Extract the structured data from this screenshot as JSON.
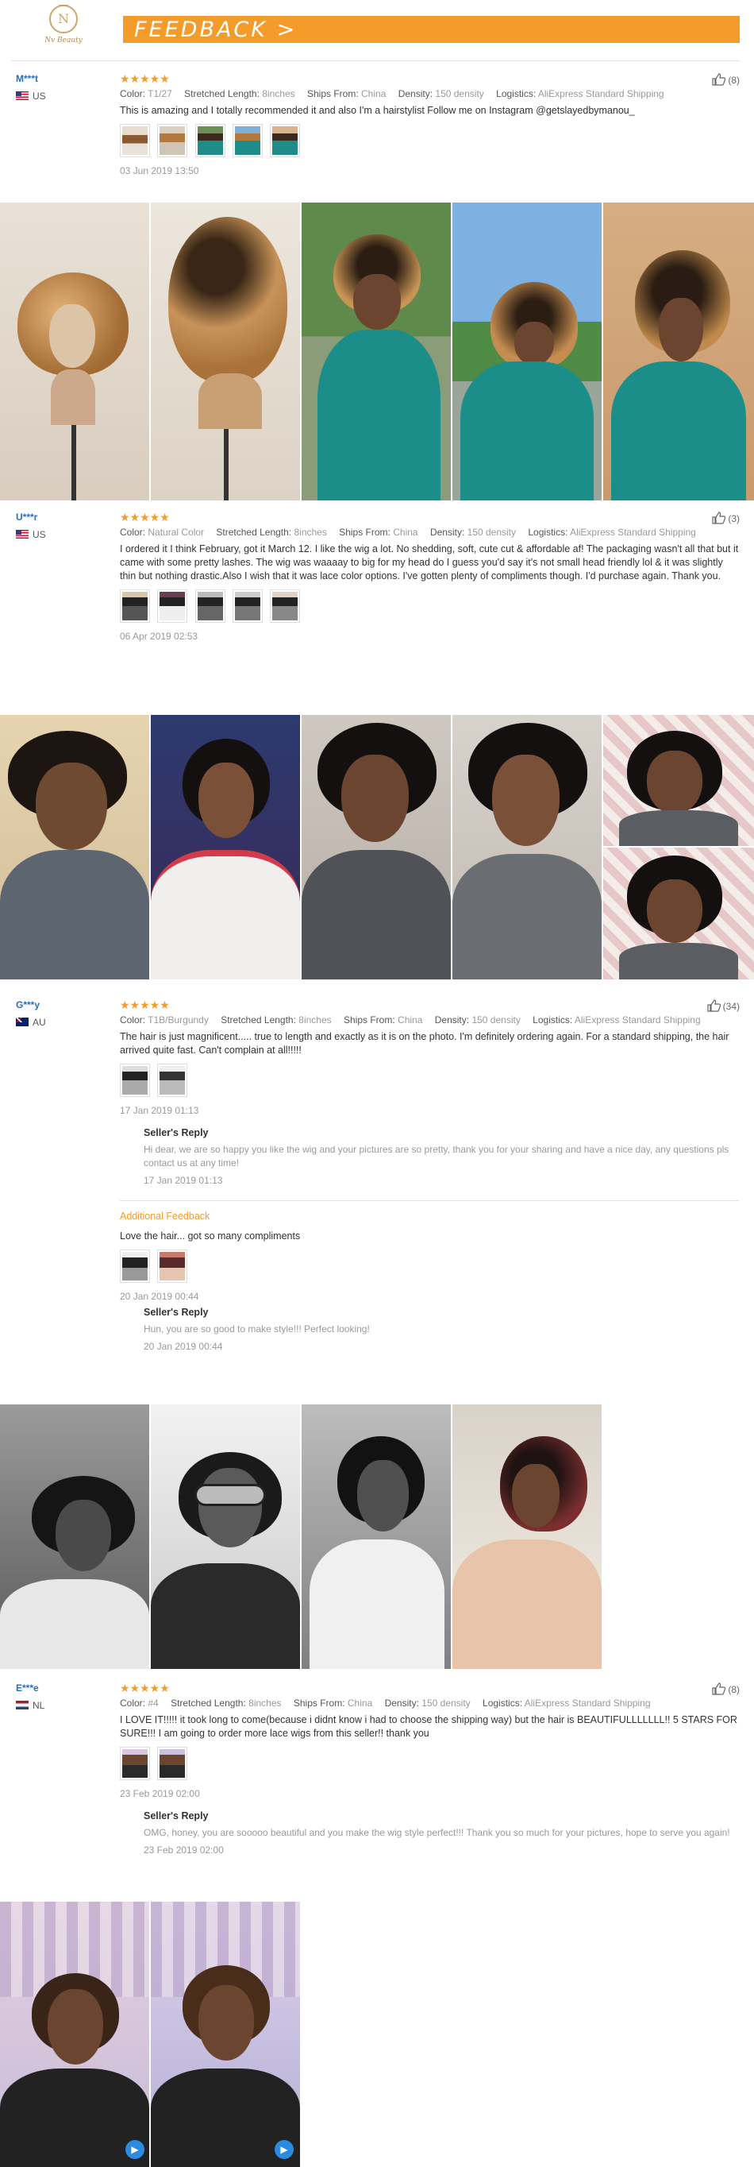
{
  "brand": {
    "logo_text": "Nv Beauty",
    "monogram": "N"
  },
  "section_title": "FEEDBACK >",
  "reviews": [
    {
      "user": "M***t",
      "country": "US",
      "stars": "★★★★★",
      "color_label": "Color:",
      "color": "T1/27",
      "length_label": "Stretched Length:",
      "length": "8inches",
      "ships_label": "Ships From:",
      "ships": "China",
      "density_label": "Density:",
      "density": "150 density",
      "logistics_label": "Logistics:",
      "logistics": "AliExpress Standard Shipping",
      "likes": "(8)",
      "text": "This is amazing and I totally recommended it and also I'm a hairstylist Follow me on Instagram @getslayedbymanou_",
      "date": "03 Jun 2019 13:50"
    },
    {
      "user": "U***r",
      "country": "US",
      "stars": "★★★★★",
      "color_label": "Color:",
      "color": "Natural Color",
      "length_label": "Stretched Length:",
      "length": "8inches",
      "ships_label": "Ships From:",
      "ships": "China",
      "density_label": "Density:",
      "density": "150 density",
      "logistics_label": "Logistics:",
      "logistics": "AliExpress Standard Shipping",
      "likes": "(3)",
      "text": "I ordered it I think February, got it March 12. I like the wig a lot. No shedding, soft, cute cut & affordable af! The packaging wasn't all that but it came with some pretty lashes. The wig was waaaay to big for my head do I guess you'd say it's not small head friendly lol & it was slightly thin but nothing drastic.Also I wish that it was lace color options. I've gotten plenty of compliments though. I'd purchase again. Thank you.",
      "date": "06 Apr 2019 02:53"
    },
    {
      "user": "G***y",
      "country": "AU",
      "stars": "★★★★★",
      "color_label": "Color:",
      "color": "T1B/Burgundy",
      "length_label": "Stretched Length:",
      "length": "8inches",
      "ships_label": "Ships From:",
      "ships": "China",
      "density_label": "Density:",
      "density": "150 density",
      "logistics_label": "Logistics:",
      "logistics": "AliExpress Standard Shipping",
      "likes": "(34)",
      "text": "The hair is just magnificent..... true to length and exactly as it is on the photo. I'm definitely ordering again. For a standard shipping, the hair arrived quite fast. Can't complain at all!!!!!",
      "date": "17 Jan 2019 01:13",
      "reply_title": "Seller's Reply",
      "reply_text": "Hi dear, we are so happy you like the wig and your pictures are so pretty, thank you for your sharing and have a nice day, any questions pls contact us at any time!",
      "reply_date": "17 Jan 2019 01:13",
      "additional_title": "Additional Feedback",
      "additional_text": "Love the hair... got so many compliments",
      "additional_date": "20 Jan 2019 00:44",
      "additional_reply_title": "Seller's Reply",
      "additional_reply_text": "Hun, you are so good to make style!!! Perfect looking!",
      "additional_reply_date": "20 Jan 2019 00:44"
    },
    {
      "user": "E***e",
      "country": "NL",
      "stars": "★★★★★",
      "color_label": "Color:",
      "color": "#4",
      "length_label": "Stretched Length:",
      "length": "8inches",
      "ships_label": "Ships From:",
      "ships": "China",
      "density_label": "Density:",
      "density": "150 density",
      "logistics_label": "Logistics:",
      "logistics": "AliExpress Standard Shipping",
      "likes": "(8)",
      "text": "I LOVE IT!!!!! it took long to come(because i didnt know i had to choose the shipping way) but the hair is BEAUTIFULLLLLLL!! 5 STARS FOR SURE!!! I am going to order more lace wigs from this seller!! thank you",
      "date": "23 Feb 2019 02:00",
      "reply_title": "Seller's Reply",
      "reply_text": "OMG, honey, you are sooooo beautiful and you make the wig style perfect!!! Thank you so much for your pictures, hope to serve you again!",
      "reply_date": "23 Feb 2019 02:00"
    }
  ],
  "colors": {
    "accent": "#f59b2a",
    "user_link": "#2a6ebb",
    "muted": "#999999"
  }
}
